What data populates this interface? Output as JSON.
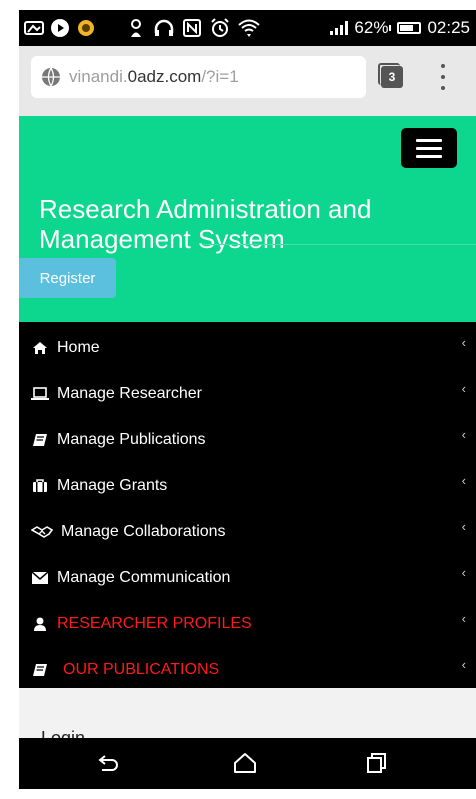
{
  "status_bar": {
    "battery_percent": "62%",
    "time": "02:25",
    "icons": [
      "gallery-icon",
      "play-icon",
      "app-icon",
      "touch-icon",
      "headphones-icon",
      "nfc-icon",
      "alarm-icon",
      "wifi-icon",
      "signal-icon",
      "battery-icon"
    ]
  },
  "browser": {
    "url_prefix": "vinandi.",
    "url_domain": "0adz.com",
    "url_path": "/?i=1",
    "tab_count": "3"
  },
  "header": {
    "title": "Research Administration and Management System",
    "register_label": "Register",
    "accent_color": "#0dd68f"
  },
  "menu": {
    "items": [
      {
        "label": "Home",
        "icon": "home-icon"
      },
      {
        "label": "Manage Researcher",
        "icon": "laptop-icon"
      },
      {
        "label": "Manage Publications",
        "icon": "book-icon"
      },
      {
        "label": "Manage Grants",
        "icon": "briefcase-icon"
      },
      {
        "label": "Manage Collaborations",
        "icon": "handshake-icon"
      },
      {
        "label": "Manage Communication",
        "icon": "envelope-icon"
      },
      {
        "label": "RESEARCHER PROFILES",
        "icon": "user-icon"
      },
      {
        "label": "OUR PUBLICATIONS",
        "icon": "book-icon"
      }
    ],
    "chevron": "‹"
  },
  "login_section": {
    "heading": "Login"
  },
  "nav_bar": {
    "buttons": [
      "back-icon",
      "home-icon",
      "recents-icon"
    ]
  }
}
